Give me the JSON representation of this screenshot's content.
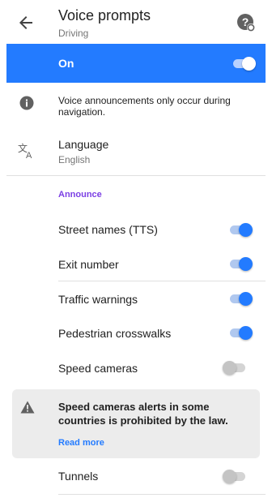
{
  "header": {
    "title": "Voice prompts",
    "subtitle": "Driving",
    "back_icon": "arrow-left-icon",
    "help_icon": "help-icon"
  },
  "master": {
    "label": "On",
    "enabled": true
  },
  "info": {
    "icon": "info-icon",
    "text": "Voice announcements only occur during navigation."
  },
  "language": {
    "icon": "translate-icon",
    "label": "Language",
    "value": "English"
  },
  "announce": {
    "title": "Announce",
    "items": [
      {
        "label": "Street names (TTS)",
        "enabled": true
      },
      {
        "label": "Exit number",
        "enabled": true
      },
      {
        "label": "Traffic warnings",
        "enabled": true
      },
      {
        "label": "Pedestrian crosswalks",
        "enabled": true
      },
      {
        "label": "Speed cameras",
        "enabled": false
      }
    ]
  },
  "warning": {
    "icon": "warning-icon",
    "text": "Speed cameras alerts in some countries is prohibited by the law.",
    "link": "Read more"
  },
  "tunnels": {
    "label": "Tunnels",
    "enabled": false
  },
  "colors": {
    "accent": "#237bff",
    "section": "#7b3fe4",
    "warning_bg": "#ececec"
  }
}
